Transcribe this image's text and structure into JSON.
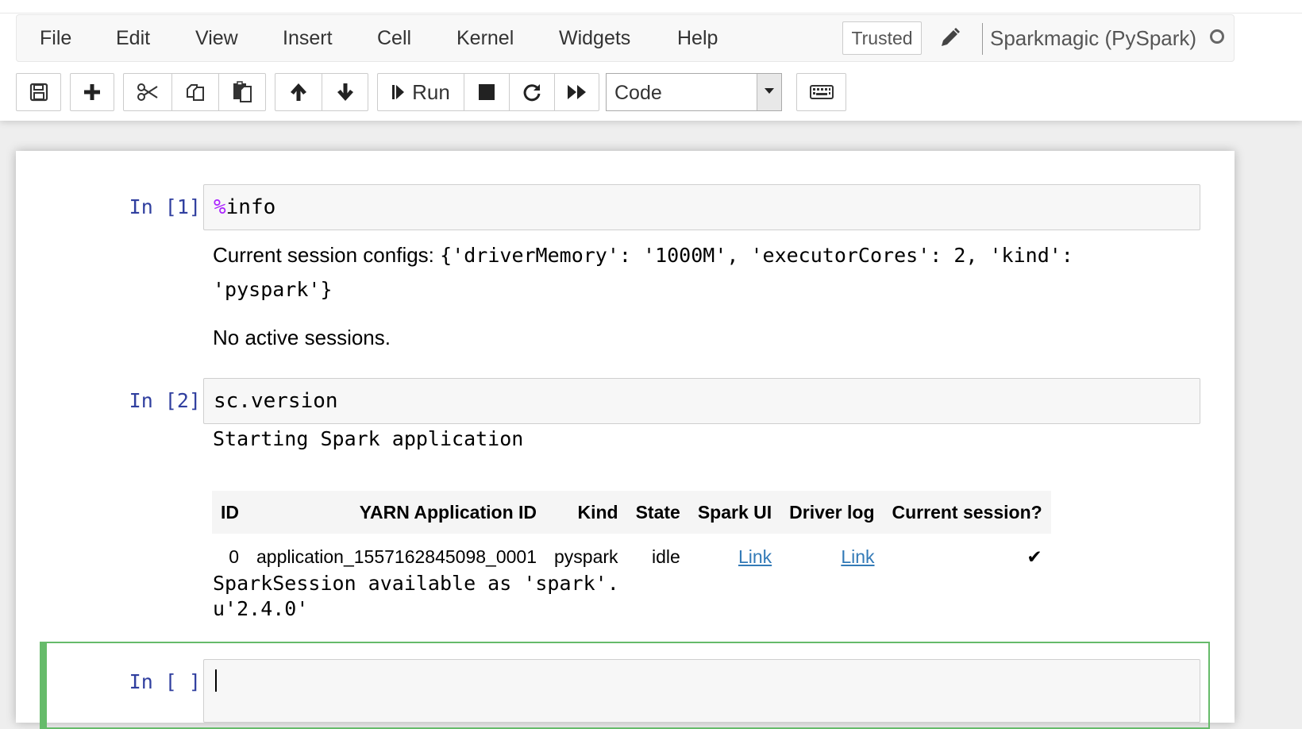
{
  "menu": {
    "items": [
      "File",
      "Edit",
      "View",
      "Insert",
      "Cell",
      "Kernel",
      "Widgets",
      "Help"
    ],
    "trusted_label": "Trusted",
    "kernel_name": "Sparkmagic (PySpark)"
  },
  "toolbar": {
    "run_label": "Run",
    "cell_type": "Code",
    "icons": [
      "save-icon",
      "plus-icon",
      "scissors-icon",
      "copy-icon",
      "paste-icon",
      "arrow-up-icon",
      "arrow-down-icon",
      "run-icon",
      "stop-icon",
      "restart-icon",
      "fast-forward-icon",
      "keyboard-icon"
    ]
  },
  "cells": [
    {
      "prompt": "In [1]:",
      "magic": "%",
      "source": "info",
      "output_prefix": "Current session configs: ",
      "output_config_1": "{'driverMemory': '1000M', 'executorCores': 2, 'kind':",
      "output_config_2": "'pyspark'}",
      "output_status": "No active sessions."
    },
    {
      "prompt": "In [2]:",
      "source": "sc.version",
      "output_start": "Starting Spark application",
      "table": {
        "headers": [
          "ID",
          "YARN Application ID",
          "Kind",
          "State",
          "Spark UI",
          "Driver log",
          "Current session?"
        ],
        "rows": [
          [
            "0",
            "application_1557162845098_0001",
            "pyspark",
            "idle",
            "Link",
            "Link",
            "✔"
          ]
        ]
      },
      "output_end_1": "SparkSession available as 'spark'.",
      "output_end_2": "u'2.4.0'"
    },
    {
      "prompt": "In [ ]:",
      "source": ""
    }
  ],
  "colors": {
    "prompt": "#303f9f",
    "magic": "#aa22ff",
    "selected_cell_border": "#66bb6a",
    "link": "#337ab7"
  }
}
